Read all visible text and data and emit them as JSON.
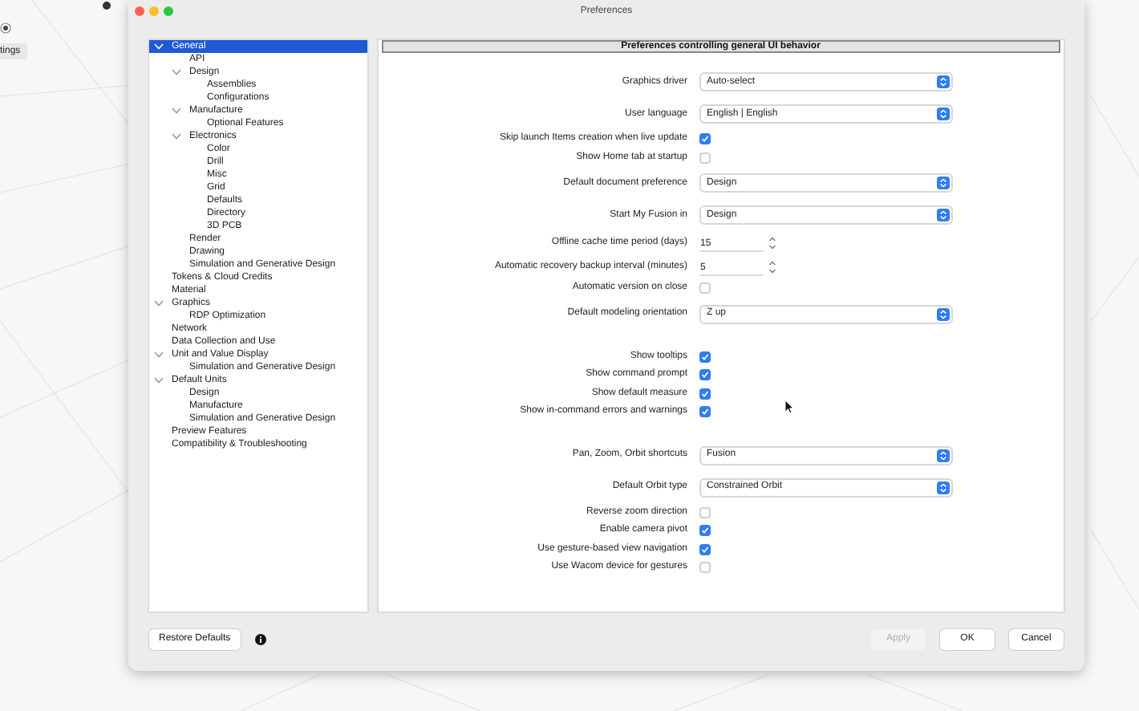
{
  "background": {
    "toolbar_label": "tings"
  },
  "window": {
    "title": "Preferences"
  },
  "sidebar": {
    "items": [
      {
        "label": "General",
        "selected": true,
        "expanded": true,
        "children": [
          {
            "label": "API",
            "selected": false
          },
          {
            "label": "Design",
            "selected": false,
            "expanded": true,
            "children": [
              {
                "label": "Assemblies",
                "selected": false
              },
              {
                "label": "Configurations",
                "selected": false
              }
            ]
          },
          {
            "label": "Manufacture",
            "selected": false,
            "expanded": true,
            "children": [
              {
                "label": "Optional Features",
                "selected": false
              }
            ]
          },
          {
            "label": "Electronics",
            "selected": false,
            "expanded": true,
            "children": [
              {
                "label": "Color",
                "selected": false
              },
              {
                "label": "Drill",
                "selected": false
              },
              {
                "label": "Misc",
                "selected": false
              },
              {
                "label": "Grid",
                "selected": false
              },
              {
                "label": "Defaults",
                "selected": false
              },
              {
                "label": "Directory",
                "selected": false
              },
              {
                "label": "3D PCB",
                "selected": false
              }
            ]
          },
          {
            "label": "Render",
            "selected": false
          },
          {
            "label": "Drawing",
            "selected": false
          },
          {
            "label": "Simulation and Generative Design",
            "selected": false
          }
        ]
      },
      {
        "label": "Tokens & Cloud Credits",
        "selected": false
      },
      {
        "label": "Material",
        "selected": false
      },
      {
        "label": "Graphics",
        "selected": false,
        "expanded": true,
        "children": [
          {
            "label": "RDP Optimization",
            "selected": false
          }
        ]
      },
      {
        "label": "Network",
        "selected": false
      },
      {
        "label": "Data Collection and Use",
        "selected": false
      },
      {
        "label": "Unit and Value Display",
        "selected": false,
        "expanded": true,
        "children": [
          {
            "label": "Simulation and Generative Design",
            "selected": false
          }
        ]
      },
      {
        "label": "Default Units",
        "selected": false,
        "expanded": true,
        "children": [
          {
            "label": "Design",
            "selected": false
          },
          {
            "label": "Manufacture",
            "selected": false
          },
          {
            "label": "Simulation and Generative Design",
            "selected": false
          }
        ]
      },
      {
        "label": "Preview Features",
        "selected": false
      },
      {
        "label": "Compatibility & Troubleshooting",
        "selected": false
      }
    ]
  },
  "panel": {
    "header": "Preferences controlling general UI behavior",
    "groups": [
      [
        {
          "kind": "select",
          "label": "Graphics driver",
          "value": "Auto-select"
        },
        {
          "kind": "select",
          "label": "User language",
          "value": "English | English"
        },
        {
          "kind": "checkbox",
          "label": "Skip launch Items creation when live update",
          "checked": true
        },
        {
          "kind": "checkbox",
          "label": "Show Home tab at startup",
          "checked": false
        },
        {
          "kind": "select",
          "label": "Default document preference",
          "value": "Design"
        },
        {
          "kind": "select",
          "label": "Start My Fusion in",
          "value": "Design"
        },
        {
          "kind": "spinner",
          "label": "Offline cache time period (days)",
          "value": "15"
        },
        {
          "kind": "spinner",
          "label": "Automatic recovery backup interval (minutes)",
          "value": "5"
        },
        {
          "kind": "checkbox",
          "label": "Automatic version on close",
          "checked": false
        },
        {
          "kind": "select",
          "label": "Default modeling orientation",
          "value": "Z up"
        }
      ],
      [
        {
          "kind": "checkbox",
          "label": "Show tooltips",
          "checked": true
        },
        {
          "kind": "checkbox",
          "label": "Show command prompt",
          "checked": true
        },
        {
          "kind": "checkbox",
          "label": "Show default measure",
          "checked": true
        },
        {
          "kind": "checkbox",
          "label": "Show in-command errors and warnings",
          "checked": true
        }
      ],
      [
        {
          "kind": "select",
          "label": "Pan, Zoom, Orbit shortcuts",
          "value": "Fusion"
        },
        {
          "kind": "select",
          "label": "Default Orbit type",
          "value": "Constrained Orbit"
        },
        {
          "kind": "checkbox",
          "label": "Reverse zoom direction",
          "checked": false
        },
        {
          "kind": "checkbox",
          "label": "Enable camera pivot",
          "checked": true
        },
        {
          "kind": "checkbox",
          "label": "Use gesture-based view navigation",
          "checked": true
        },
        {
          "kind": "checkbox",
          "label": "Use Wacom device for gestures",
          "checked": false
        }
      ]
    ]
  },
  "footer": {
    "restore": "Restore Defaults",
    "buttons": [
      {
        "label": "Apply",
        "disabled": true
      },
      {
        "label": "OK",
        "disabled": false
      },
      {
        "label": "Cancel",
        "disabled": false
      }
    ]
  }
}
